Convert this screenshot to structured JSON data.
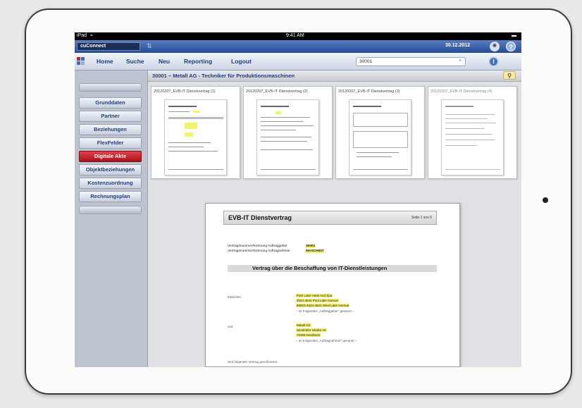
{
  "statusbar": {
    "device": "iPad",
    "time": "9:41 AM"
  },
  "appbar": {
    "app_name": "cuConnect",
    "date": "30.12.2012"
  },
  "nav": {
    "home": "Home",
    "search": "Suche",
    "new": "Neu",
    "reporting": "Reporting",
    "logout": "Logout"
  },
  "search": {
    "value": "30001",
    "go": ">"
  },
  "sidebar": {
    "items": [
      {
        "label": "Grunddaten"
      },
      {
        "label": "Partner"
      },
      {
        "label": "Beziehungen"
      },
      {
        "label": "FlexFelder"
      },
      {
        "label": "Digitale Akte"
      },
      {
        "label": "Objektbeziehungen"
      },
      {
        "label": "Kostenzuordnung"
      },
      {
        "label": "Rechnungsplan"
      }
    ],
    "active_index": 4
  },
  "main": {
    "title": "30001 – Metall AG - Techniker für Produktionsmaschinen",
    "thumbnails": [
      {
        "label": "20120207_EVB-IT Dienstvertrag (1)"
      },
      {
        "label": "20120207_EVB-IT Dienstvertrag (2)"
      },
      {
        "label": "20120207_EVB-IT Dienstvertrag (3)"
      },
      {
        "label": "20120207_EVB-IT Dienstvertrag (4)"
      }
    ]
  },
  "document": {
    "title": "EVB-IT Dienstvertrag",
    "page": "Seite 1 von 5",
    "auftraggeber_label": "Vertragsnummer/Kennung Auftraggeber",
    "auftraggeber_value": "30001",
    "auftragnehmer_label": "Vertragsnummer/Kennung Auftragnehmer",
    "auftragnehmer_value": "MASCH007",
    "section_title": "Vertrag über die Beschaffung von IT-Dienstleistungen",
    "zwischen": "Zwischen",
    "party1": [
      "Park Lake Hotel And Spa",
      "4524-4524 Pool Lake Avenue",
      "80503-4524-4524 West Lake Avenue"
    ],
    "party1_note": "– im Folgenden „Auftraggeber“ genannt –",
    "und": "und",
    "party2": [
      "Metall AG",
      "Steinhöfer Straße 10",
      "70469 Nordheim"
    ],
    "party2_note": "– im Folgenden „Auftragnehmer“ genannt –",
    "footer": "wird folgender Vertrag geschlossen:"
  },
  "colors": {
    "accent_blue": "#254b96",
    "active_red": "#c0202a",
    "highlight": "#f4f06a"
  }
}
